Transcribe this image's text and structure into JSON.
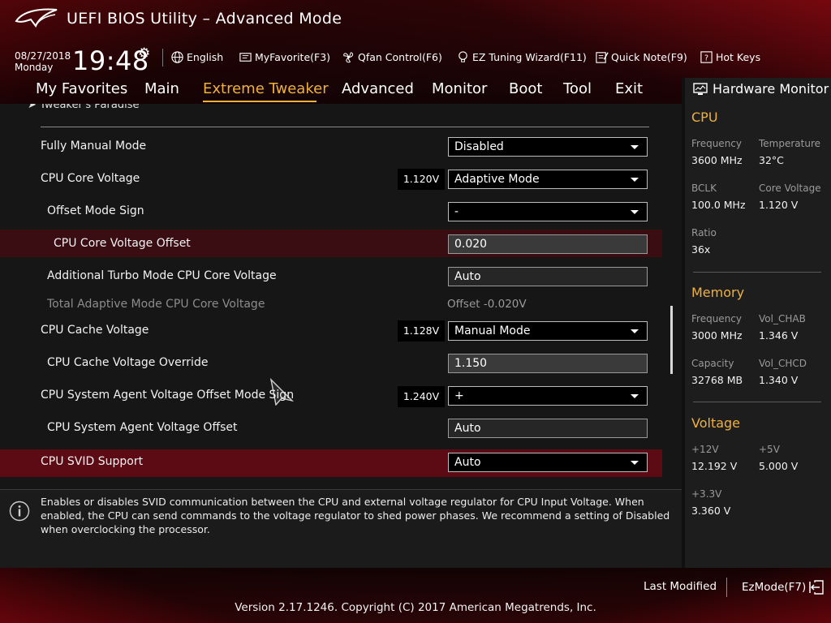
{
  "header": {
    "title": "UEFI BIOS Utility – Advanced Mode",
    "date": "08/27/2018",
    "day": "Monday",
    "time": "19:48",
    "tools": [
      {
        "label": "English",
        "icon": "globe-icon"
      },
      {
        "label": "MyFavorite(F3)",
        "icon": "favorite-icon"
      },
      {
        "label": "Qfan Control(F6)",
        "icon": "fan-icon"
      },
      {
        "label": "EZ Tuning Wizard(F11)",
        "icon": "bulb-icon"
      },
      {
        "label": "Quick Note(F9)",
        "icon": "note-icon"
      },
      {
        "label": "Hot Keys",
        "icon": "hotkeys-icon"
      }
    ]
  },
  "nav": {
    "tabs": [
      "My Favorites",
      "Main",
      "Extreme Tweaker",
      "Advanced",
      "Monitor",
      "Boot",
      "Tool",
      "Exit"
    ],
    "active": "Extreme Tweaker"
  },
  "breadcrumb": "Tweaker's Paradise",
  "settings": {
    "fully_manual_mode": {
      "label": "Fully Manual Mode",
      "value": "Disabled"
    },
    "cpu_core_voltage": {
      "label": "CPU Core Voltage",
      "reading": "1.120V",
      "value": "Adaptive Mode"
    },
    "offset_mode_sign": {
      "label": "Offset Mode Sign",
      "value": "-"
    },
    "cpu_core_voltage_offset": {
      "label": "CPU Core Voltage Offset",
      "value": "0.020"
    },
    "additional_turbo": {
      "label": "Additional Turbo Mode CPU Core Voltage",
      "value": "Auto"
    },
    "total_adaptive": {
      "label": "Total Adaptive Mode CPU Core Voltage",
      "value": "Offset -0.020V"
    },
    "cpu_cache_voltage": {
      "label": "CPU Cache Voltage",
      "reading": "1.128V",
      "value": "Manual Mode"
    },
    "cpu_cache_override": {
      "label": "CPU Cache Voltage Override",
      "value": "1.150"
    },
    "sa_offset_sign": {
      "label": "CPU System Agent Voltage Offset Mode Sign",
      "reading": "1.240V",
      "value": "+"
    },
    "sa_offset": {
      "label": "CPU System Agent Voltage Offset",
      "value": "Auto"
    },
    "svid_support": {
      "label": "CPU SVID Support",
      "value": "Auto"
    }
  },
  "help": {
    "text": "Enables or disables SVID communication between the CPU and external voltage regulator for CPU Input Voltage. When enabled, the CPU can send commands to the voltage regulator to shed power phases. We recommend a setting of Disabled when overclocking the processor."
  },
  "hw_monitor": {
    "title": "Hardware Monitor",
    "cpu": {
      "heading": "CPU",
      "frequency_label": "Frequency",
      "frequency": "3600 MHz",
      "temperature_label": "Temperature",
      "temperature": "32°C",
      "bclk_label": "BCLK",
      "bclk": "100.0 MHz",
      "core_voltage_label": "Core Voltage",
      "core_voltage": "1.120 V",
      "ratio_label": "Ratio",
      "ratio": "36x"
    },
    "memory": {
      "heading": "Memory",
      "frequency_label": "Frequency",
      "frequency": "3000 MHz",
      "vol_chab_label": "Vol_CHAB",
      "vol_chab": "1.346 V",
      "capacity_label": "Capacity",
      "capacity": "32768 MB",
      "vol_chcd_label": "Vol_CHCD",
      "vol_chcd": "1.340 V"
    },
    "voltage": {
      "heading": "Voltage",
      "v12_label": "+12V",
      "v12": "12.192 V",
      "v5_label": "+5V",
      "v5": "5.000 V",
      "v33_label": "+3.3V",
      "v33": "3.360 V"
    }
  },
  "footer": {
    "last_modified": "Last Modified",
    "ezmode": "EzMode(F7)",
    "version": "Version 2.17.1246. Copyright (C) 2017 American Megatrends, Inc."
  },
  "colors": {
    "accent": "#f0b13c",
    "highlight_row": "#5c0b14",
    "brand_red": "#b40a14"
  }
}
